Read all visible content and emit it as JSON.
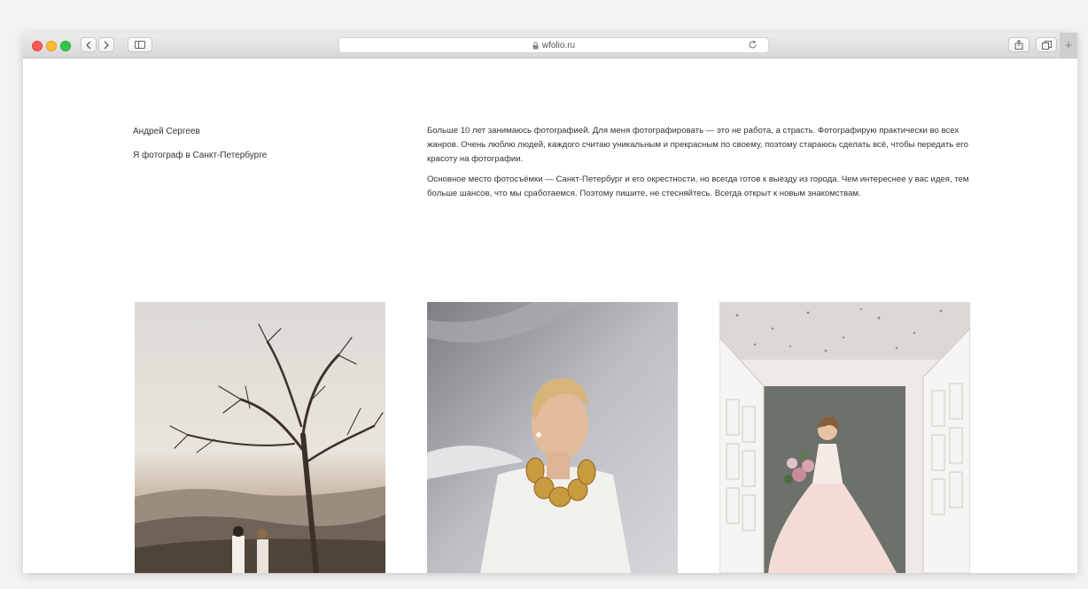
{
  "browser": {
    "url": "wfolio.ru",
    "new_tab_label": "+",
    "back_icon": "chevron-left-icon",
    "forward_icon": "chevron-right-icon",
    "sidebar_icon": "sidebar-icon",
    "lock_icon": "lock-icon",
    "reload_icon": "reload-icon",
    "share_icon": "share-icon",
    "tabs_icon": "tabs-icon"
  },
  "profile": {
    "name": "Андрей Сергеев",
    "tagline": "Я фотограф в Санкт-Петербурге"
  },
  "bio": {
    "paragraph_1": "Больше 10 лет занимаюсь фотографией. Для меня фотографировать — это не работа, а страсть. Фотографирую практически во всех жанров. Очень люблю людей, каждого считаю уникальным и прекрасным по своему, поэтому стараюсь сделать всё, чтобы передать его красоту на фотографии.",
    "paragraph_2": "Основное место фотосъёмки — Санкт-Петербург и его окрестности, но всегда готов к выезду из города. Чем интереснее у вас идея, тем больше шансов, что мы сработаемся. Поэтому пишите, не стесняйтесь. Всегда открыт к новым знакомствам."
  },
  "gallery": {
    "photos": [
      "couple-under-tree-photo",
      "woman-with-gold-necklace-photo",
      "bride-with-bouquet-photo"
    ]
  }
}
